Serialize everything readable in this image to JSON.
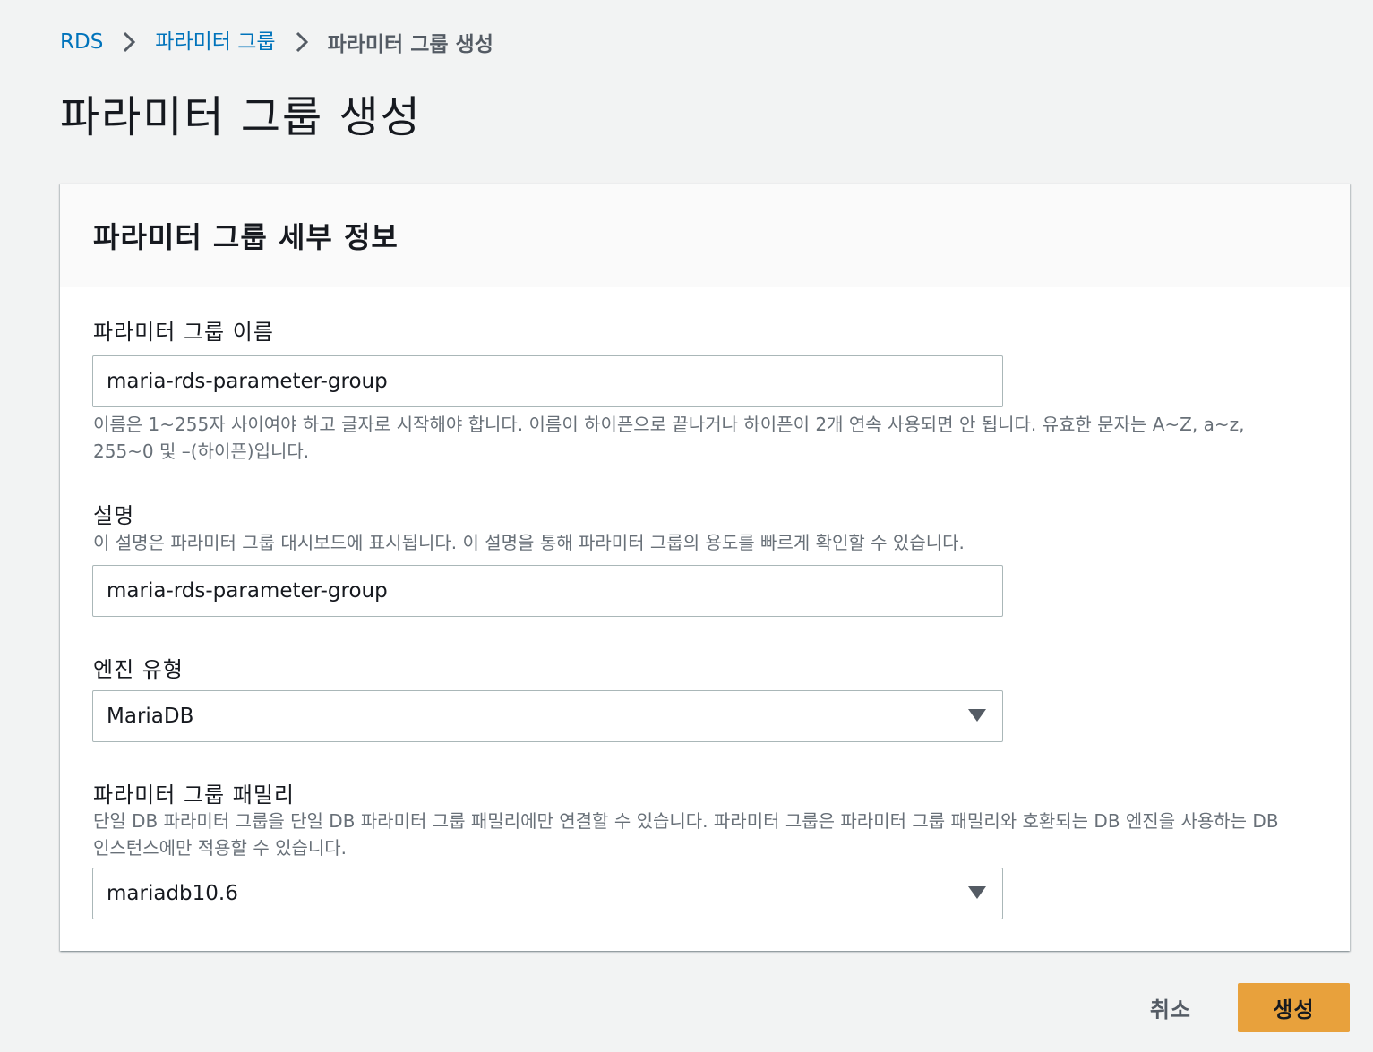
{
  "breadcrumb": {
    "items": [
      {
        "label": "RDS"
      },
      {
        "label": "파라미터 그룹"
      },
      {
        "label": "파라미터 그룹 생성"
      }
    ],
    "separator_icon": "chevron-right-icon"
  },
  "page": {
    "title": "파라미터 그룹 생성"
  },
  "panel": {
    "title": "파라미터 그룹 세부 정보",
    "fields": {
      "name": {
        "label": "파라미터 그룹 이름",
        "value": "maria-rds-parameter-group",
        "description": "이름은 1~255자 사이여야 하고 글자로 시작해야 합니다. 이름이 하이픈으로 끝나거나 하이픈이 2개 연속 사용되면 안 됩니다. 유효한 문자는 A~Z, a~z, 255~0 및 –(하이픈)입니다."
      },
      "description": {
        "label": "설명",
        "description": "이 설명은 파라미터 그룹 대시보드에 표시됩니다. 이 설명을 통해 파라미터 그룹의 용도를 빠르게 확인할 수 있습니다.",
        "value": "maria-rds-parameter-group"
      },
      "engine_type": {
        "label": "엔진 유형",
        "selected": "MariaDB"
      },
      "family": {
        "label": "파라미터 그룹 패밀리",
        "description": "단일 DB 파라미터 그룹을 단일 DB 파라미터 그룹 패밀리에만 연결할 수 있습니다. 파라미터 그룹은 파라미터 그룹 패밀리와 호환되는 DB 엔진을 사용하는 DB 인스턴스에만 적용할 수 있습니다.",
        "selected": "mariadb10.6"
      }
    }
  },
  "actions": {
    "cancel_label": "취소",
    "create_label": "생성"
  },
  "colors": {
    "link": "#0073bb",
    "primary_button": "#e8a13c",
    "background": "#f2f3f3"
  }
}
